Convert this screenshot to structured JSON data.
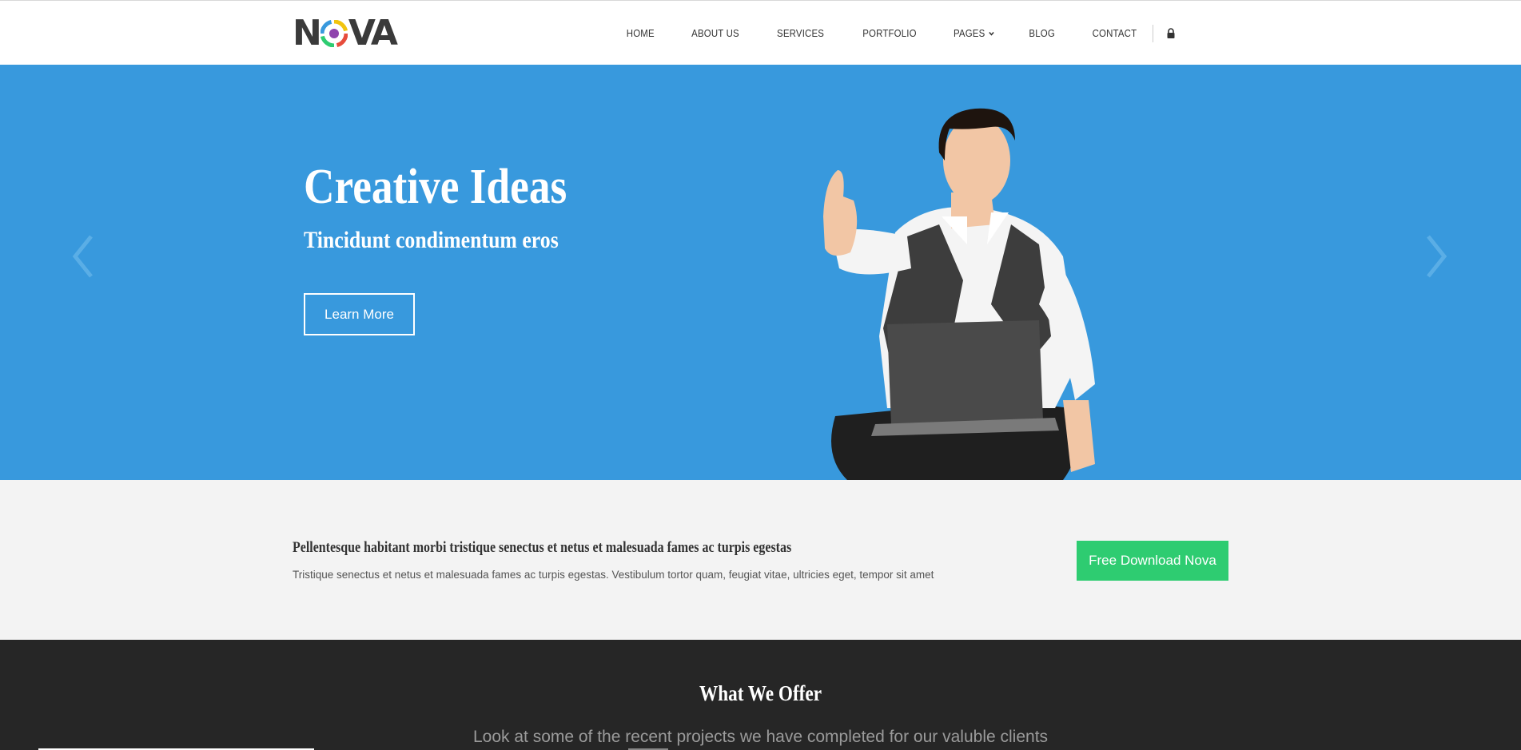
{
  "brand": {
    "name_before": "N",
    "name_after": "VA",
    "accent": "#3899dd",
    "green": "#2ecc71",
    "dark": "#262626"
  },
  "nav": {
    "items": [
      "HOME",
      "ABOUT US",
      "SERVICES",
      "PORTFOLIO",
      "PAGES",
      "BLOG",
      "CONTACT"
    ],
    "pages_icon": "chevron-down-icon",
    "lock_icon": "lock-icon"
  },
  "hero": {
    "title": "Creative Ideas",
    "subtitle": "Tincidunt condimentum eros",
    "button": "Learn More",
    "prev_icon": "chevron-left-icon",
    "next_icon": "chevron-right-icon"
  },
  "promo": {
    "title": "Pellentesque habitant morbi tristique senectus et netus et malesuada fames ac turpis egestas",
    "text": "Tristique senectus et netus et malesuada fames ac turpis egestas. Vestibulum tortor quam, feugiat vitae, ultricies eget, tempor sit amet",
    "button": "Free Download Nova"
  },
  "offer": {
    "title": "What We Offer",
    "subtitle": "Look at some of the recent projects we have completed for our valuble clients"
  }
}
